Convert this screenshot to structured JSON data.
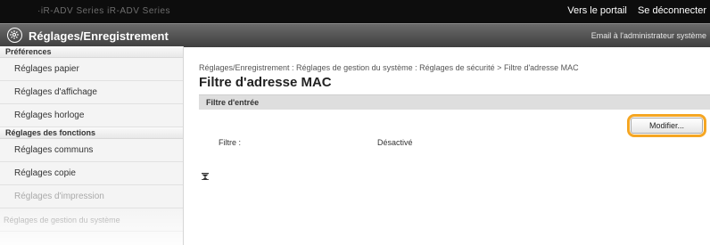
{
  "topbar": {
    "device_name": "·iR-ADV  Series  iR-ADV  Series",
    "portal_link": "Vers le portail",
    "logout_link": "Se déconnecter"
  },
  "titlebar": {
    "icon": "settings-gear-icon",
    "title": "Réglages/Enregistrement",
    "email_admin": "Email à l'administrateur système"
  },
  "sidebar": {
    "sections": [
      {
        "label": "Préférences",
        "items": [
          "Réglages papier",
          "Réglages d'affichage",
          "Réglages horloge"
        ]
      },
      {
        "label": "Réglages des fonctions",
        "items": [
          "Réglages communs",
          "Réglages copie",
          "Réglages d'impression",
          "Réglages de gestion du système"
        ]
      }
    ]
  },
  "main": {
    "breadcrumb": "Réglages/Enregistrement : Réglages de gestion du système : Réglages de sécurité > Filtre d'adresse MAC",
    "page_title": "Filtre d'adresse MAC",
    "section_title": "Filtre d'entrée",
    "edit_button": "Modifier...",
    "field_label": "Filtre :",
    "field_value": "Désactivé",
    "scroll_top_icon": "scroll-to-top-icon"
  },
  "colors": {
    "highlight": "#f5a623",
    "topbar": "#0d0d0d",
    "titlebar": "#4f4f4f"
  }
}
